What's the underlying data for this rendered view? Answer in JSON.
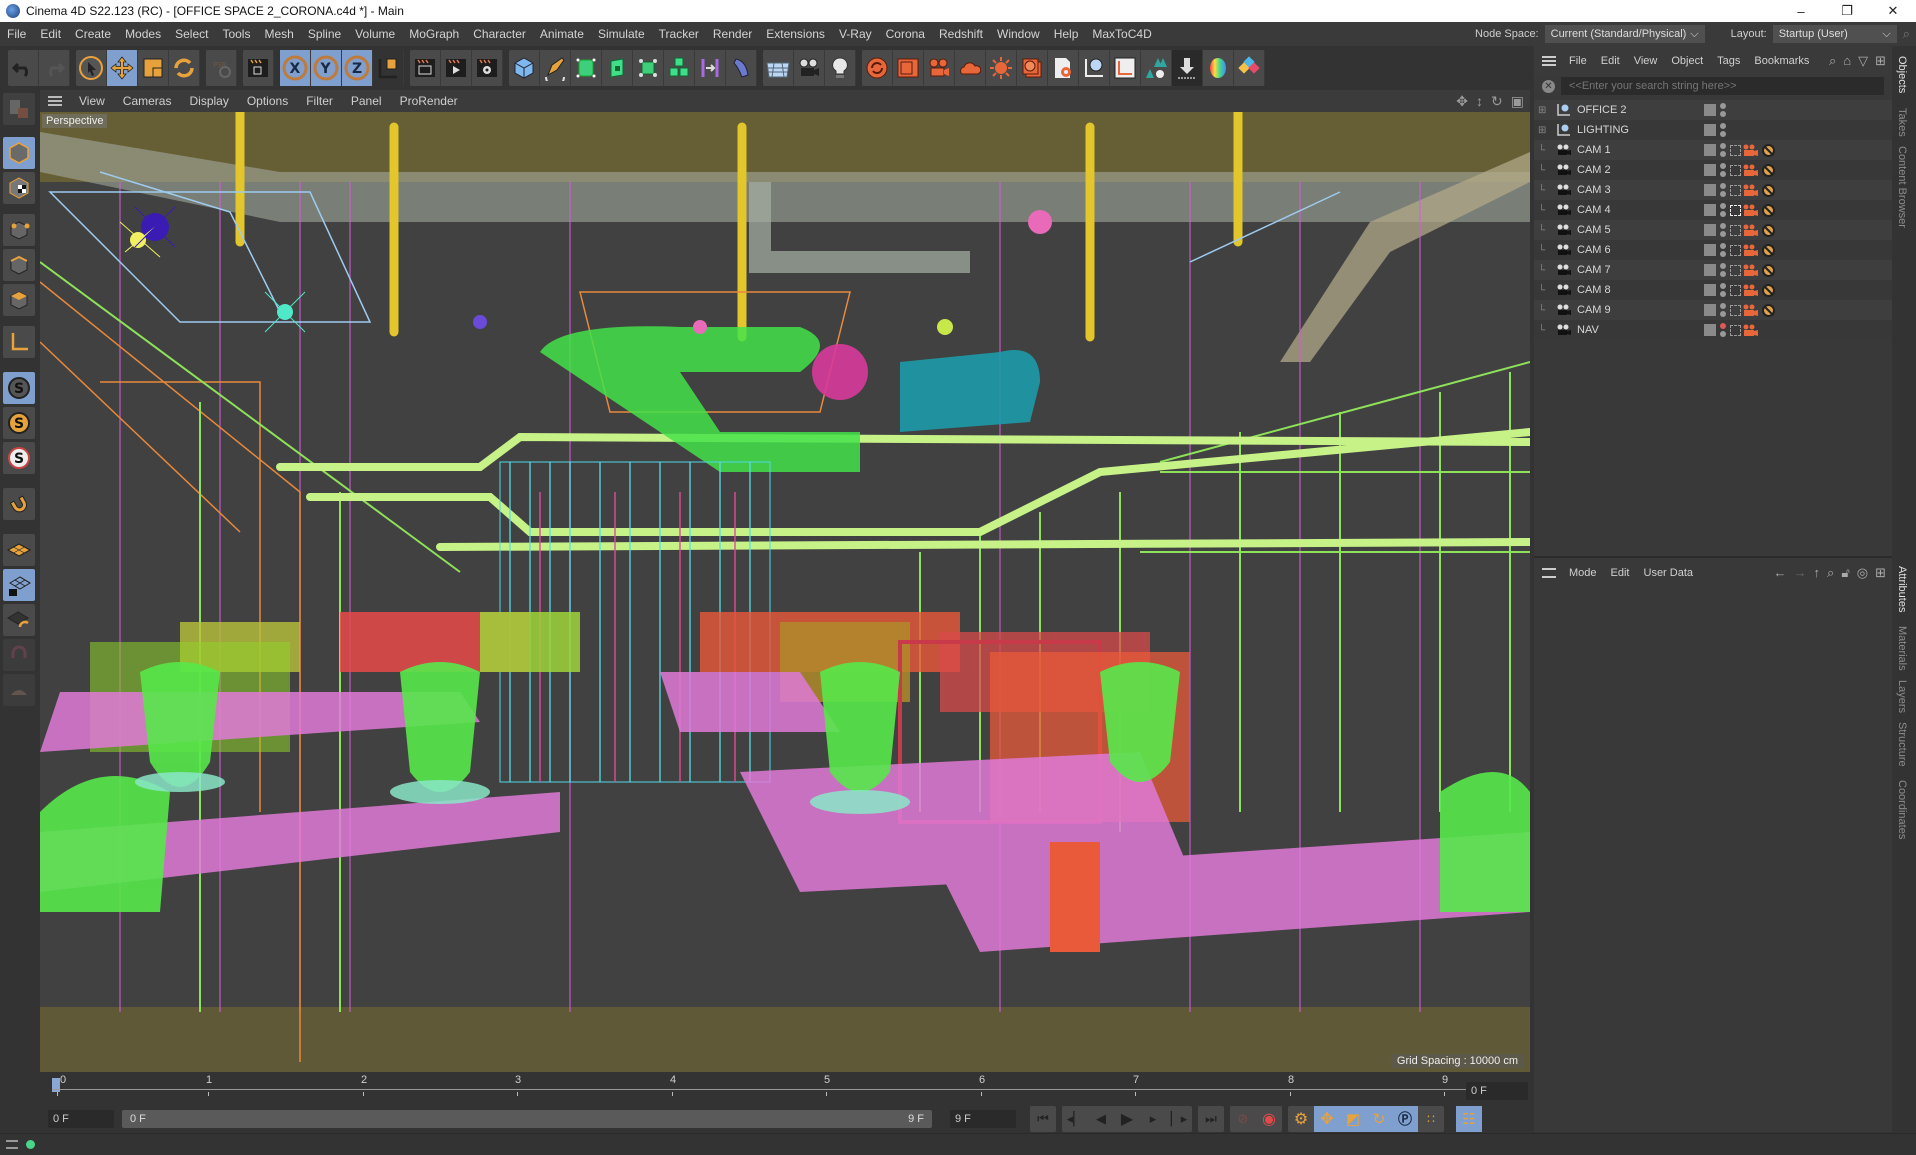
{
  "window": {
    "title": "Cinema 4D S22.123 (RC) - [OFFICE SPACE 2_CORONA.c4d *] - Main",
    "controls": {
      "minimize": "–",
      "restore": "❐",
      "close": "✕"
    }
  },
  "menubar": {
    "items": [
      "File",
      "Edit",
      "Create",
      "Modes",
      "Select",
      "Tools",
      "Mesh",
      "Spline",
      "Volume",
      "MoGraph",
      "Character",
      "Animate",
      "Simulate",
      "Tracker",
      "Render",
      "Extensions",
      "V-Ray",
      "Corona",
      "Redshift",
      "Window",
      "Help",
      "MaxToC4D"
    ],
    "node_space_label": "Node Space:",
    "node_space_value": "Current (Standard/Physical)",
    "layout_label": "Layout:",
    "layout_value": "Startup (User)"
  },
  "toolbar": {
    "groups": [
      [
        "undo-icon",
        "redo-icon"
      ],
      [
        "live-selection-icon",
        "move-icon",
        "scale-icon",
        "rotate-icon"
      ],
      [
        "recent-tools-icon"
      ],
      [
        "render-region-icon"
      ],
      [
        "x-axis-lock-icon",
        "y-axis-lock-icon",
        "z-axis-lock-icon"
      ],
      [
        "coordinate-system-icon"
      ],
      [
        "render-view-icon",
        "render-to-picture-viewer-icon",
        "render-settings-icon"
      ],
      [
        "cube-icon",
        "pen-icon",
        "subdivision-icon",
        "extrude-icon",
        "cloner-icon",
        "mograph-icon",
        "symmetry-icon",
        "deformer-icon"
      ],
      [
        "floor-icon",
        "camera-icon",
        "light-icon"
      ],
      [
        "corona-ipr-icon",
        "corona-vfb-icon",
        "corona-camera-icon",
        "corona-sky-icon",
        "corona-sun-icon",
        "corona-material-icon",
        "corona-settings-icon",
        "corona-light-mix-icon",
        "corona-tools-icon",
        "scatter-icon",
        "proxy-export-icon",
        "color-icon",
        "plugin-icon"
      ]
    ],
    "active": [
      "move-icon",
      "x-axis-lock-icon",
      "y-axis-lock-icon",
      "z-axis-lock-icon"
    ]
  },
  "left_tools": {
    "items": [
      "make-editable-icon",
      "model-mode-icon",
      "texture-mode-icon",
      "points-mode-icon",
      "edges-mode-icon",
      "polygons-mode-icon",
      "axis-mode-icon",
      "solo-off-icon",
      "solo-single-icon",
      "solo-hierarchy-icon",
      "snap-icon",
      "workplane-icon",
      "locked-workplane-icon",
      "workplane-align-icon",
      "magnet-icon",
      "sculpt-icon"
    ],
    "active": [
      "model-mode-icon",
      "solo-off-icon",
      "locked-workplane-icon"
    ]
  },
  "viewport": {
    "menu": [
      "View",
      "Cameras",
      "Display",
      "Options",
      "Filter",
      "Panel",
      "ProRender"
    ],
    "camera_label": "Perspective",
    "grid_spacing": "Grid Spacing : 10000 cm"
  },
  "timeline": {
    "ticks": [
      "0",
      "1",
      "2",
      "3",
      "4",
      "5",
      "6",
      "7",
      "8",
      "9"
    ],
    "current_frame": "0 F",
    "start_frame": "0 F",
    "range_start": "0 F",
    "range_end": "9 F",
    "end_frame": "9 F"
  },
  "transport": {
    "buttons": [
      "go-to-start-icon",
      "go-to-first-key-icon",
      "previous-frame-icon",
      "play-icon",
      "next-frame-icon",
      "go-to-last-key-icon",
      "go-to-end-icon",
      "record-keys-icon",
      "autokey-icon",
      "keyframe-selection-icon",
      "move-key-icon",
      "scale-key-icon",
      "rotate-key-icon",
      "param-key-icon",
      "point-level-icon",
      "timeline-icon"
    ]
  },
  "object_manager": {
    "menu": [
      "File",
      "Edit",
      "View",
      "Object",
      "Tags",
      "Bookmarks"
    ],
    "search_placeholder": "<<Enter your search string here>>",
    "objects": [
      {
        "name": "OFFICE 2",
        "type": "null",
        "expandable": true,
        "tags": []
      },
      {
        "name": "LIGHTING",
        "type": "null",
        "expandable": true,
        "tags": []
      },
      {
        "name": "CAM 1",
        "type": "camera",
        "tags": [
          "corona-camera",
          "protection"
        ]
      },
      {
        "name": "CAM 2",
        "type": "camera",
        "tags": [
          "corona-camera",
          "protection"
        ]
      },
      {
        "name": "CAM 3",
        "type": "camera",
        "tags": [
          "corona-camera",
          "protection"
        ]
      },
      {
        "name": "CAM 4",
        "type": "camera",
        "tags": [
          "corona-camera",
          "protection"
        ],
        "active_camera": true
      },
      {
        "name": "CAM 5",
        "type": "camera",
        "tags": [
          "corona-camera",
          "protection"
        ]
      },
      {
        "name": "CAM 6",
        "type": "camera",
        "tags": [
          "corona-camera",
          "protection"
        ]
      },
      {
        "name": "CAM 7",
        "type": "camera",
        "tags": [
          "corona-camera",
          "protection"
        ]
      },
      {
        "name": "CAM 8",
        "type": "camera",
        "tags": [
          "corona-camera",
          "protection"
        ]
      },
      {
        "name": "CAM 9",
        "type": "camera",
        "tags": [
          "corona-camera",
          "protection"
        ]
      },
      {
        "name": "NAV",
        "type": "camera",
        "tags": [
          "corona-camera"
        ],
        "render_off": true
      }
    ]
  },
  "attribute_manager": {
    "menu": [
      "Mode",
      "Edit",
      "User Data"
    ]
  },
  "side_tabs": {
    "top": [
      "Objects",
      "Takes",
      "Content Browser"
    ],
    "bottom": [
      "Attributes",
      "Materials",
      "Layers",
      "Structure",
      "Coordinates"
    ]
  },
  "colors": {
    "ui_bg": "#333333",
    "panel_bg": "#393939",
    "active_button": "#7f9fcf",
    "accent_orange": "#e8a23c",
    "status_green": "#49d58a",
    "viewport_bg": "#414141"
  }
}
